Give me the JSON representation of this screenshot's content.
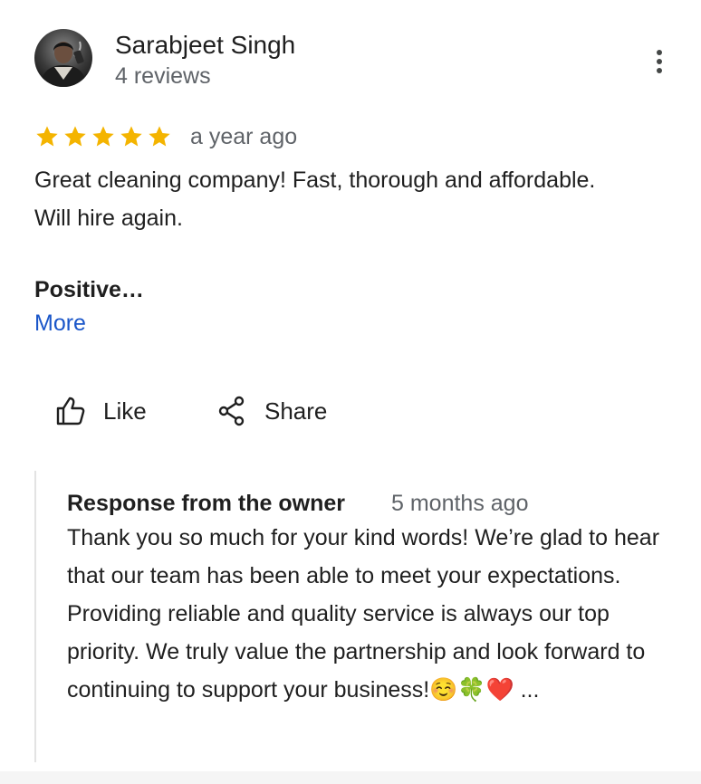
{
  "review": {
    "reviewer_name": "Sarabjeet Singh",
    "review_count": "4 reviews",
    "avatar_icon": "user-avatar-photo",
    "menu_icon": "more-vert-icon",
    "rating": 5,
    "rating_max": 5,
    "star_color": "#f4b400",
    "date": "a year ago",
    "text": "Great cleaning company! Fast, thorough and affordable. Will hire again.",
    "positive_label": "Positive…",
    "more_label": "More",
    "link_color": "#1a56c9"
  },
  "actions": {
    "like": {
      "label": "Like",
      "icon": "thumb-up-icon"
    },
    "share": {
      "label": "Share",
      "icon": "share-icon"
    }
  },
  "owner_response": {
    "heading": "Response from the owner",
    "date": "5 months ago",
    "text": "Thank you so much for your kind words! We’re glad to hear that our team has been able to meet your expectations. Providing reliable and quality service is always our top priority. We truly value the partnership and look forward to continuing to support your business!☺️🍀❤️ ..."
  }
}
